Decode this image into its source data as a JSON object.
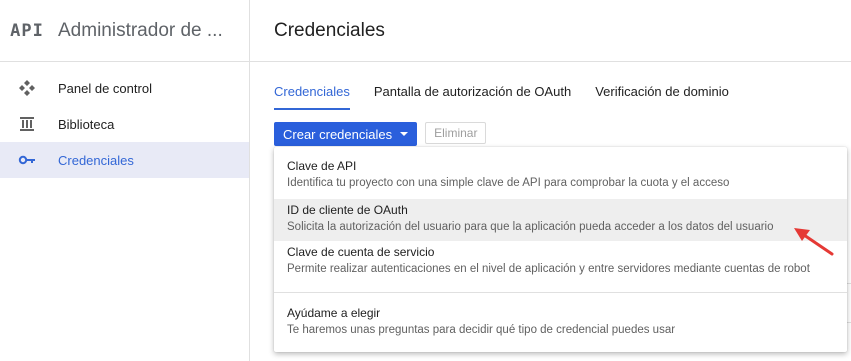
{
  "sidebar": {
    "logo": "API",
    "title": "Administrador de ...",
    "items": [
      {
        "label": "Panel de control",
        "icon": "dashboard-icon",
        "active": false
      },
      {
        "label": "Biblioteca",
        "icon": "library-icon",
        "active": false
      },
      {
        "label": "Credenciales",
        "icon": "key-icon",
        "active": true
      }
    ]
  },
  "main": {
    "title": "Credenciales",
    "tabs": [
      {
        "label": "Credenciales",
        "active": true
      },
      {
        "label": "Pantalla de autorización de OAuth",
        "active": false
      },
      {
        "label": "Verificación de dominio",
        "active": false
      }
    ],
    "toolbar": {
      "create_label": "Crear credenciales",
      "delete_label": "Eliminar"
    }
  },
  "dropdown": {
    "items": [
      {
        "title": "Clave de API",
        "description": "Identifica tu proyecto con una simple clave de API para comprobar la cuota y el acceso"
      },
      {
        "title": "ID de cliente de OAuth",
        "description": "Solicita la autorización del usuario para que la aplicación pueda acceder a los datos del usuario",
        "highlighted": true
      },
      {
        "title": "Clave de cuenta de servicio",
        "description": "Permite realizar autenticaciones en el nivel de aplicación y entre servidores mediante cuentas de robot"
      },
      {
        "title": "Ayúdame a elegir",
        "description": "Te haremos unas preguntas para decidir qué tipo de credencial puedes usar"
      }
    ]
  },
  "colors": {
    "accent": "#3367d6",
    "button": "#2a5fdc",
    "active_bg": "#e8eaf6",
    "highlight_bg": "#eeeeee",
    "annotation_arrow": "#e53935"
  }
}
